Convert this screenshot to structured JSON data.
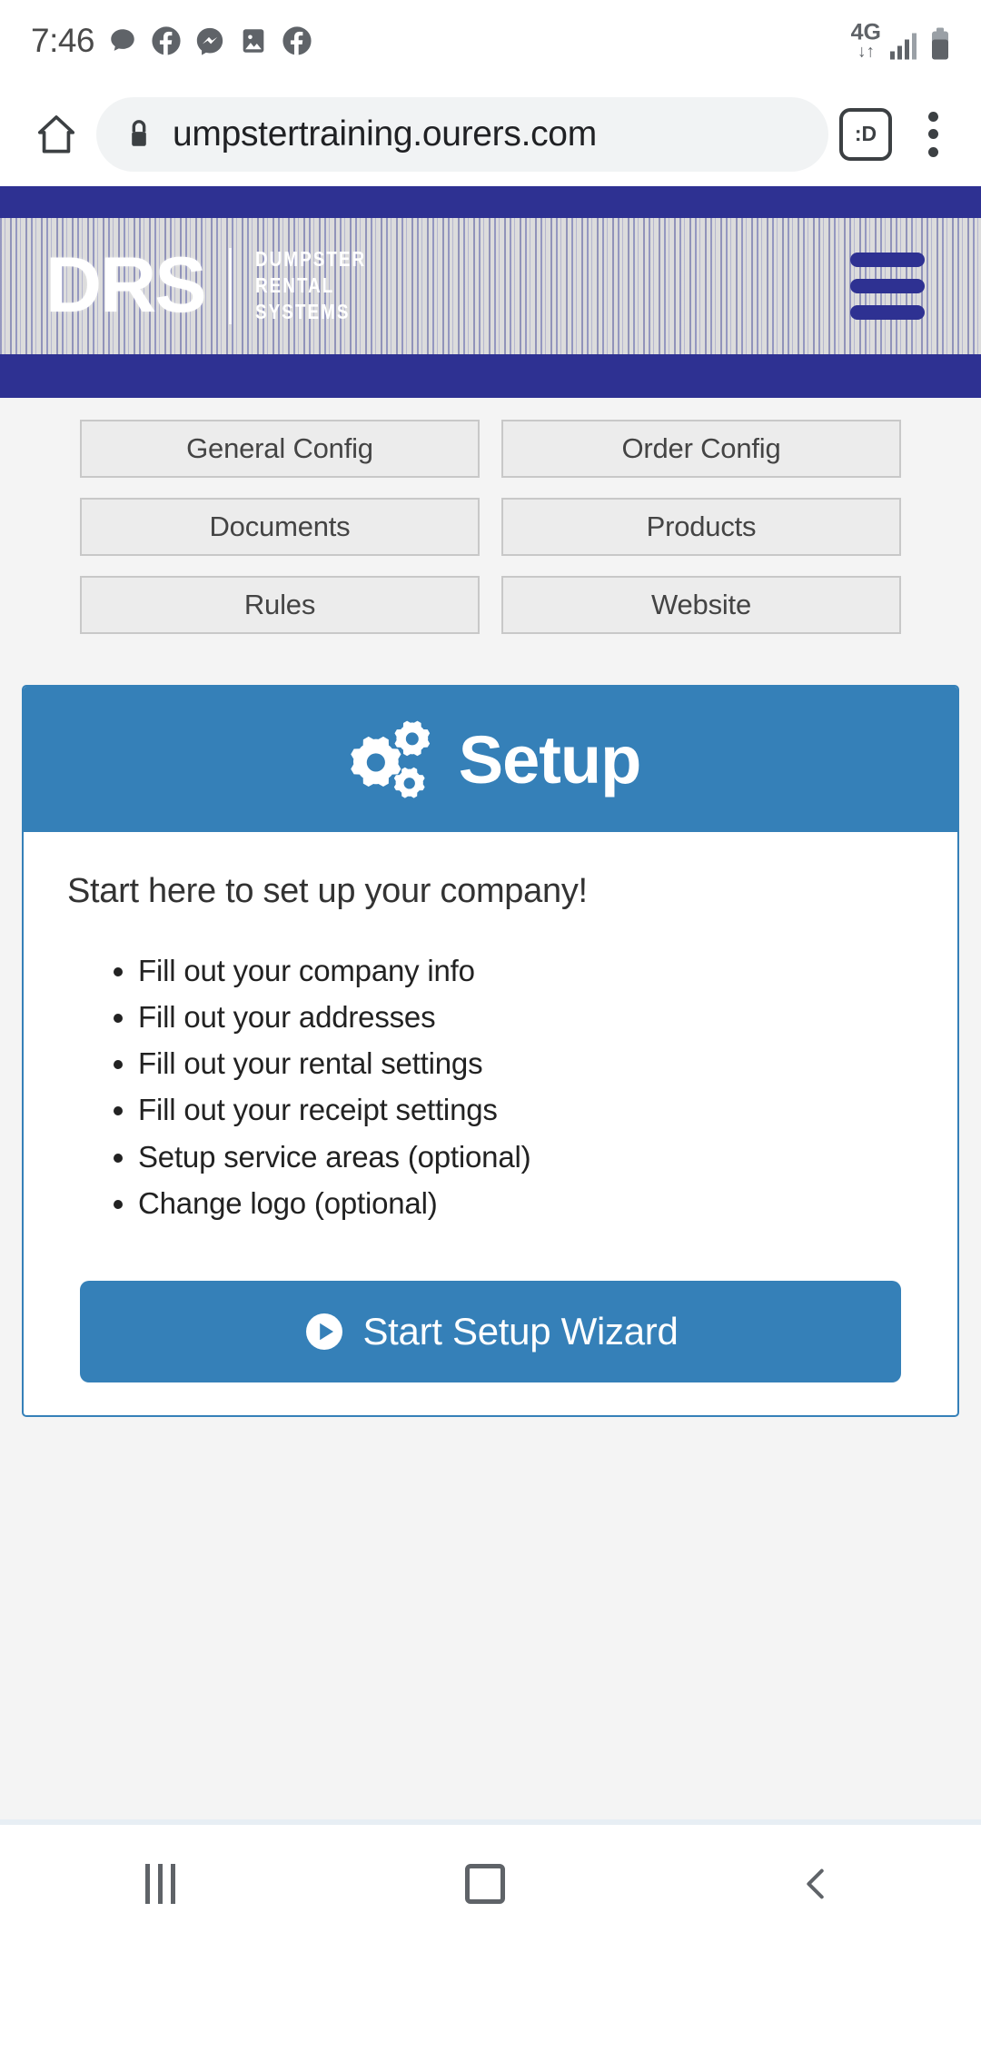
{
  "statusbar": {
    "time": "7:46",
    "notification_icons": [
      "chat-bubble-icon",
      "facebook-icon",
      "messenger-icon",
      "photos-icon",
      "facebook-icon"
    ],
    "network": "4G",
    "network_arrows": "↓↑",
    "signal_icon": "signal-bars-icon",
    "battery_icon": "battery-icon"
  },
  "browser": {
    "home_icon": "home-icon",
    "lock_icon": "lock-icon",
    "url": "umpstertraining.ourers.com",
    "tab_count_label": ":D",
    "menu_icon": "kebab-menu-icon"
  },
  "site_header": {
    "logo_mark": "DRS",
    "logo_words": [
      "DUMPSTER",
      "RENTAL",
      "SYSTEMS"
    ],
    "menu_icon": "hamburger-menu-icon",
    "bar_color": "#2e3192"
  },
  "nav_buttons": [
    {
      "label": "General Config"
    },
    {
      "label": "Order Config"
    },
    {
      "label": "Documents"
    },
    {
      "label": "Products"
    },
    {
      "label": "Rules"
    },
    {
      "label": "Website"
    }
  ],
  "setup_card": {
    "icon": "cogs-icon",
    "title": "Setup",
    "lead": "Start here to set up your company!",
    "steps": [
      "Fill out your company info",
      "Fill out your addresses",
      "Fill out your rental settings",
      "Fill out your receipt settings",
      "Setup service areas (optional)",
      "Change logo (optional)"
    ],
    "wizard_button": {
      "icon": "play-circle-icon",
      "label": "Start Setup Wizard"
    },
    "accent_color": "#3580b8"
  },
  "android_nav": {
    "recents_label": "recents-icon",
    "home_label": "home-icon",
    "back_label": "back-icon"
  }
}
